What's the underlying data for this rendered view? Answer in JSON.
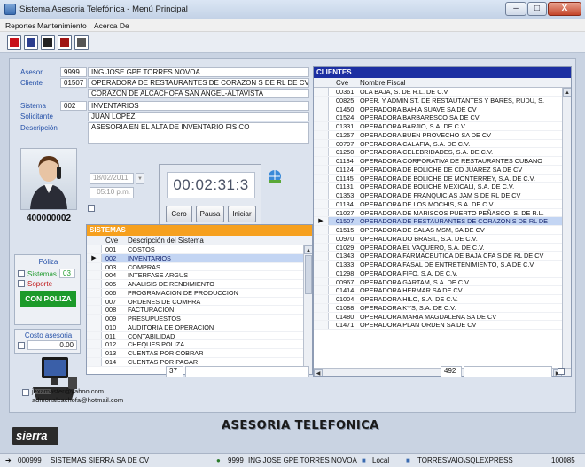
{
  "window": {
    "title": "Sistema Asesoria Telefónica  -  Menú Principal",
    "controls": [
      "–",
      "□",
      "X"
    ]
  },
  "menu": {
    "items": [
      "Reportes",
      "Mantenimiento",
      "Acerca De"
    ]
  },
  "toolbar": {
    "icons": [
      "report-icon",
      "book-icon",
      "save-icon",
      "calendar-icon",
      "window-icon"
    ]
  },
  "info": {
    "asesor_label": "Asesor",
    "asesor_code": "9999",
    "asesor_name": "ING JOSE GPE TORRES NOVOA",
    "cliente_label": "Cliente",
    "cliente_code": "01507",
    "cliente_name": "OPERADORA DE RESTAURANTES DE CORAZON S DE RL DE CV",
    "cliente_name2": "CORAZON DE ALCACHOFA SAN ANGEL-ALTAVISTA",
    "sistema_label": "Sistema",
    "sistema_code": "002",
    "sistema_name": "INVENTARIOS",
    "solicitante_label": "Solicitante",
    "solicitante_value": "JUAN LOPEZ",
    "descripcion_label": "Descripción",
    "descripcion_value": "ASESORIA EN EL ALTA DE INVENTARIO FISICO"
  },
  "call": {
    "number": "400000002",
    "date": "18/02/2011",
    "time": "05:10 p.m.",
    "timer": "00:02:31:3",
    "buttons": {
      "cero": "Cero",
      "pausa": "Pausa",
      "iniciar": "Iniciar"
    }
  },
  "poliza": {
    "title": "Póliza",
    "sistemas_label": "Sistemas",
    "sistemas_count": "03",
    "soporte_label": "Soporte",
    "con_poliza": "CON POLIZA",
    "costo_label": "Costo asesoria",
    "costo_value": "0.00"
  },
  "sistemas": {
    "header": "SISTEMAS",
    "col_cve": "Cve",
    "col_desc": "Descripción del Sistema",
    "rows": [
      {
        "cve": "001",
        "name": "COSTOS"
      },
      {
        "cve": "002",
        "name": "INVENTARIOS"
      },
      {
        "cve": "003",
        "name": "COMPRAS"
      },
      {
        "cve": "004",
        "name": "INTERFASE ARGUS"
      },
      {
        "cve": "005",
        "name": "ANALISIS DE RENDIMIENTO"
      },
      {
        "cve": "006",
        "name": "PROGRAMACION DE PRODUCCION"
      },
      {
        "cve": "007",
        "name": "ORDENES DE COMPRA"
      },
      {
        "cve": "008",
        "name": "FACTURACION"
      },
      {
        "cve": "009",
        "name": "PRESUPUESTOS"
      },
      {
        "cve": "010",
        "name": "AUDITORIA DE OPERACION"
      },
      {
        "cve": "011",
        "name": "CONTABILIDAD"
      },
      {
        "cve": "012",
        "name": "CHEQUES POLIZA"
      },
      {
        "cve": "013",
        "name": "CUENTAS POR COBRAR"
      },
      {
        "cve": "014",
        "name": "CUENTAS POR PAGAR"
      }
    ],
    "selected_index": 1,
    "count": "37"
  },
  "clientes": {
    "header": "CLIENTES",
    "col_cve": "Cve",
    "col_name": "Nombre Fiscal",
    "rows": [
      {
        "cve": "00361",
        "name": "OLA BAJA, S. DE R.L. DE C.V."
      },
      {
        "cve": "00825",
        "name": "OPER. Y ADMINIST. DE RESTAUTANTES Y BARES, RUDU, S."
      },
      {
        "cve": "01450",
        "name": "OPERADORA BAHIA SUAVE SA DE CV"
      },
      {
        "cve": "01524",
        "name": "OPERADORA BARBARESCO SA DE CV"
      },
      {
        "cve": "01331",
        "name": "OPERADORA BARJIO, S.A. DE C.V."
      },
      {
        "cve": "01257",
        "name": "OPERADORA BUEN PROVECHO SA DE CV"
      },
      {
        "cve": "00797",
        "name": "OPERADORA CALAFIA, S.A. DE C.V."
      },
      {
        "cve": "01250",
        "name": "OPERADORA CELEBRIDADES, S.A. DE C.V."
      },
      {
        "cve": "01134",
        "name": "OPERADORA CORPORATIVA DE RESTAURANTES CUBANO"
      },
      {
        "cve": "01124",
        "name": "OPERADORA DE BOLICHE DE CD JUAREZ SA DE CV"
      },
      {
        "cve": "01145",
        "name": "OPERADORA DE BOLICHE DE MONTERREY, S.A. DE C.V."
      },
      {
        "cve": "01131",
        "name": "OPERADORA DE BOLICHE MEXICALI, S.A. DE C.V."
      },
      {
        "cve": "01353",
        "name": "OPERADORA DE FRANQUICIAS JAM S DE RL DE CV"
      },
      {
        "cve": "01184",
        "name": "OPERADORA DE LOS MOCHIS, S.A. DE C.V."
      },
      {
        "cve": "01027",
        "name": "OPERADORA DE MARISCOS PUERTO PEÑASCO, S. DE R.L."
      },
      {
        "cve": "01507",
        "name": "OPERADORA DE RESTAURANTES DE CORAZON S DE RL DE"
      },
      {
        "cve": "01515",
        "name": "OPERADORA DE SALAS MSM, SA DE CV"
      },
      {
        "cve": "00970",
        "name": "OPERADORA DO BRASIL, S.A. DE C.V."
      },
      {
        "cve": "01029",
        "name": "OPERADORA EL VAQUERO, S.A. DE C.V."
      },
      {
        "cve": "01343",
        "name": "OPERADORA FARMACEUTICA DE BAJA CFA S DE RL DE CV"
      },
      {
        "cve": "01333",
        "name": "OPERADORA FASAL DE ENTRETENIMIENTO, S.A DE C.V."
      },
      {
        "cve": "01298",
        "name": "OPERADORA FIFO, S.A. DE C.V."
      },
      {
        "cve": "00967",
        "name": "OPERADORA GARTAM, S.A. DE C.V."
      },
      {
        "cve": "01414",
        "name": "OPERADORA HERMAR SA DE CV"
      },
      {
        "cve": "01004",
        "name": "OPERADORA HILO, S.A. DE C.V."
      },
      {
        "cve": "01088",
        "name": "OPERADORA KYS, S.A. DE C.V."
      },
      {
        "cve": "01480",
        "name": "OPERADORA MARIA MAGDALENA SA DE CV"
      },
      {
        "cve": "01471",
        "name": "OPERADORA PLAN ORDEN SA DE CV"
      }
    ],
    "selected_index": 15,
    "count": "492"
  },
  "emails": [
    "jexamaster@yahoo.com",
    "admonalcachofa@hotmail.com"
  ],
  "footer": {
    "brand": "sierra",
    "banner": "ASESORIA TELEFONICA"
  },
  "statusbar": {
    "company_code": "000999",
    "company_name": "SISTEMAS SIERRA SA DE CV",
    "user_code": "9999",
    "user_name": "ING JOSE GPE TORRES NOVOA",
    "location": "Local",
    "server": "TORRESVAIO\\SQLEXPRESS",
    "extra": "100085"
  },
  "colors": {
    "accent_blue": "#1c2fa2",
    "sistemas_orange": "#f6a01e",
    "poliza_green": "#1c9a2a"
  }
}
